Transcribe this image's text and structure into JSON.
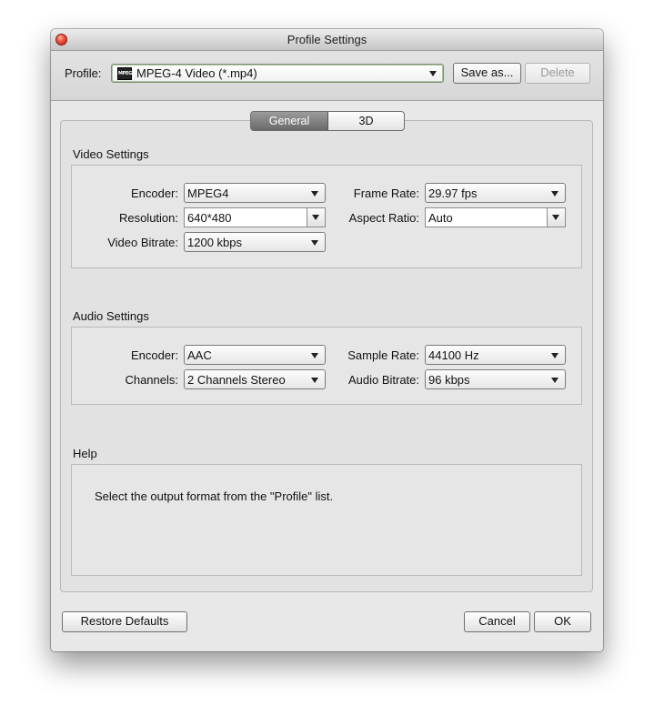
{
  "window": {
    "title": "Profile Settings"
  },
  "toolbar": {
    "profile_label": "Profile:",
    "profile_icon_text": "MPEG",
    "profile_value": "MPEG-4 Video (*.mp4)",
    "save_as_label": "Save as...",
    "delete_label": "Delete"
  },
  "tabs": [
    {
      "label": "General",
      "active": true
    },
    {
      "label": "3D",
      "active": false
    }
  ],
  "video": {
    "title": "Video Settings",
    "encoder_label": "Encoder:",
    "encoder_value": "MPEG4",
    "resolution_label": "Resolution:",
    "resolution_value": "640*480",
    "bitrate_label": "Video Bitrate:",
    "bitrate_value": "1200 kbps",
    "frame_rate_label": "Frame Rate:",
    "frame_rate_value": "29.97 fps",
    "aspect_ratio_label": "Aspect Ratio:",
    "aspect_ratio_value": "Auto"
  },
  "audio": {
    "title": "Audio Settings",
    "encoder_label": "Encoder:",
    "encoder_value": "AAC",
    "channels_label": "Channels:",
    "channels_value": "2 Channels Stereo",
    "sample_rate_label": "Sample Rate:",
    "sample_rate_value": "44100 Hz",
    "bitrate_label": "Audio Bitrate:",
    "bitrate_value": "96 kbps"
  },
  "help": {
    "title": "Help",
    "text": "Select the output format from the \"Profile\" list."
  },
  "footer": {
    "restore_label": "Restore Defaults",
    "cancel_label": "Cancel",
    "ok_label": "OK"
  },
  "colors": {
    "close_button": "#e0443a",
    "active_tab": "#7a7a7a",
    "profile_focus": "#a9c49f"
  }
}
